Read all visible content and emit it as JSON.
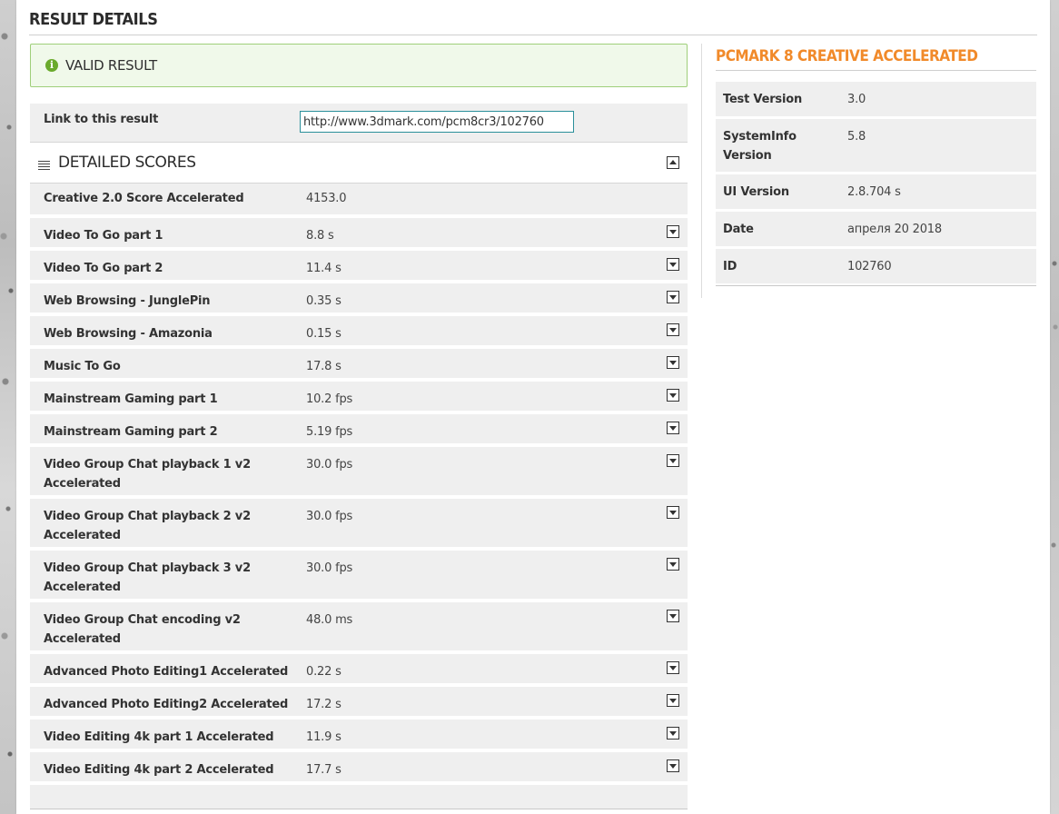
{
  "page": {
    "title": "RESULT DETAILS"
  },
  "validity": {
    "icon": "info-icon",
    "text": "VALID RESULT",
    "accent_color": "#6aaa2c",
    "border_color": "#9fcf7a",
    "background_color": "#f0f9ea"
  },
  "link": {
    "label": "Link to this result",
    "value": "http://www.3dmark.com/pcm8cr3/102760"
  },
  "detailed_scores": {
    "title": "DETAILED SCORES",
    "header_icon": "list-icon",
    "collapse_icon": "collapse-arrow-up-icon",
    "summary": {
      "name": "Creative 2.0 Score Accelerated",
      "value": "4153.0"
    },
    "rows": [
      {
        "name": "Video To Go part 1",
        "value": "8.8 s"
      },
      {
        "name": "Video To Go part 2",
        "value": "11.4 s"
      },
      {
        "name": "Web Browsing - JunglePin",
        "value": "0.35 s"
      },
      {
        "name": "Web Browsing - Amazonia",
        "value": "0.15 s"
      },
      {
        "name": "Music To Go",
        "value": "17.8 s"
      },
      {
        "name": "Mainstream Gaming part 1",
        "value": "10.2 fps"
      },
      {
        "name": "Mainstream Gaming part 2",
        "value": "5.19 fps"
      },
      {
        "name": "Video Group Chat playback 1 v2 Accelerated",
        "value": "30.0 fps"
      },
      {
        "name": "Video Group Chat playback 2 v2 Accelerated",
        "value": "30.0 fps"
      },
      {
        "name": "Video Group Chat playback 3 v2 Accelerated",
        "value": "30.0 fps"
      },
      {
        "name": "Video Group Chat encoding v2 Accelerated",
        "value": "48.0 ms"
      },
      {
        "name": "Advanced Photo Editing1 Accelerated",
        "value": "0.22 s"
      },
      {
        "name": "Advanced Photo Editing2 Accelerated",
        "value": "17.2 s"
      },
      {
        "name": "Video Editing 4k part 1 Accelerated",
        "value": "11.9 s"
      },
      {
        "name": "Video Editing 4k part 2 Accelerated",
        "value": "17.7 s"
      }
    ],
    "expand_icon": "expand-arrow-down-icon"
  },
  "benchmark": {
    "title": "PCMARK 8 CREATIVE ACCELERATED",
    "title_color": "#f18a2a",
    "info": [
      {
        "label": "Test Version",
        "value": "3.0"
      },
      {
        "label": "SystemInfo Version",
        "value": "5.8"
      },
      {
        "label": "UI Version",
        "value": "2.8.704 s"
      },
      {
        "label": "Date",
        "value": "апреля 20 2018"
      },
      {
        "label": "ID",
        "value": "102760"
      }
    ]
  }
}
